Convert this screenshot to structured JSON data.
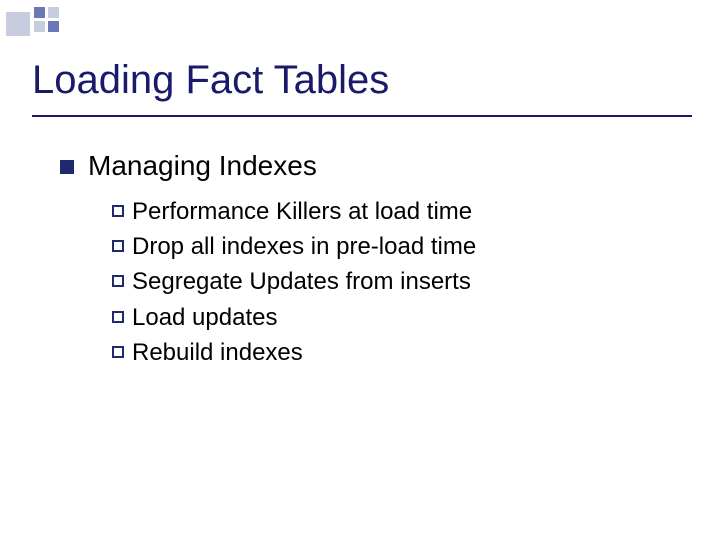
{
  "title": "Loading Fact Tables",
  "level1": "Managing Indexes",
  "items": [
    "Performance Killers at load time",
    "Drop all indexes in pre-load time",
    "Segregate Updates from inserts",
    "Load updates",
    "Rebuild indexes"
  ]
}
